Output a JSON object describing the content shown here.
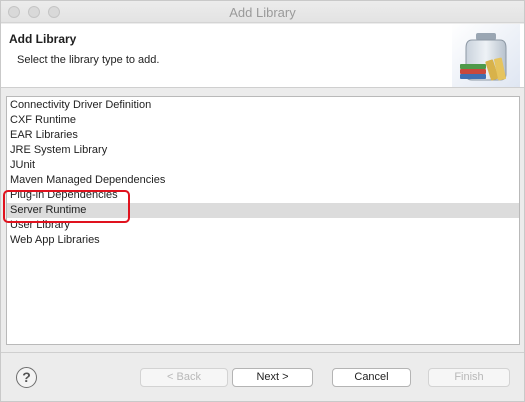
{
  "window": {
    "title": "Add Library"
  },
  "banner": {
    "title": "Add Library",
    "description": "Select the library type to add.",
    "icon": "library-jar-books-icon"
  },
  "library_list": {
    "items": [
      "Connectivity Driver Definition",
      "CXF Runtime",
      "EAR Libraries",
      "JRE System Library",
      "JUnit",
      "Maven Managed Dependencies",
      "Plug-in Dependencies",
      "Server Runtime",
      "User Library",
      "Web App Libraries"
    ],
    "selected": "Server Runtime"
  },
  "highlight": {
    "color": "#e0121e",
    "target": "Server Runtime"
  },
  "footer": {
    "help_icon": "help-question-icon",
    "help_glyph": "?",
    "back_label": "< Back",
    "next_label": "Next >",
    "cancel_label": "Cancel",
    "finish_label": "Finish"
  }
}
